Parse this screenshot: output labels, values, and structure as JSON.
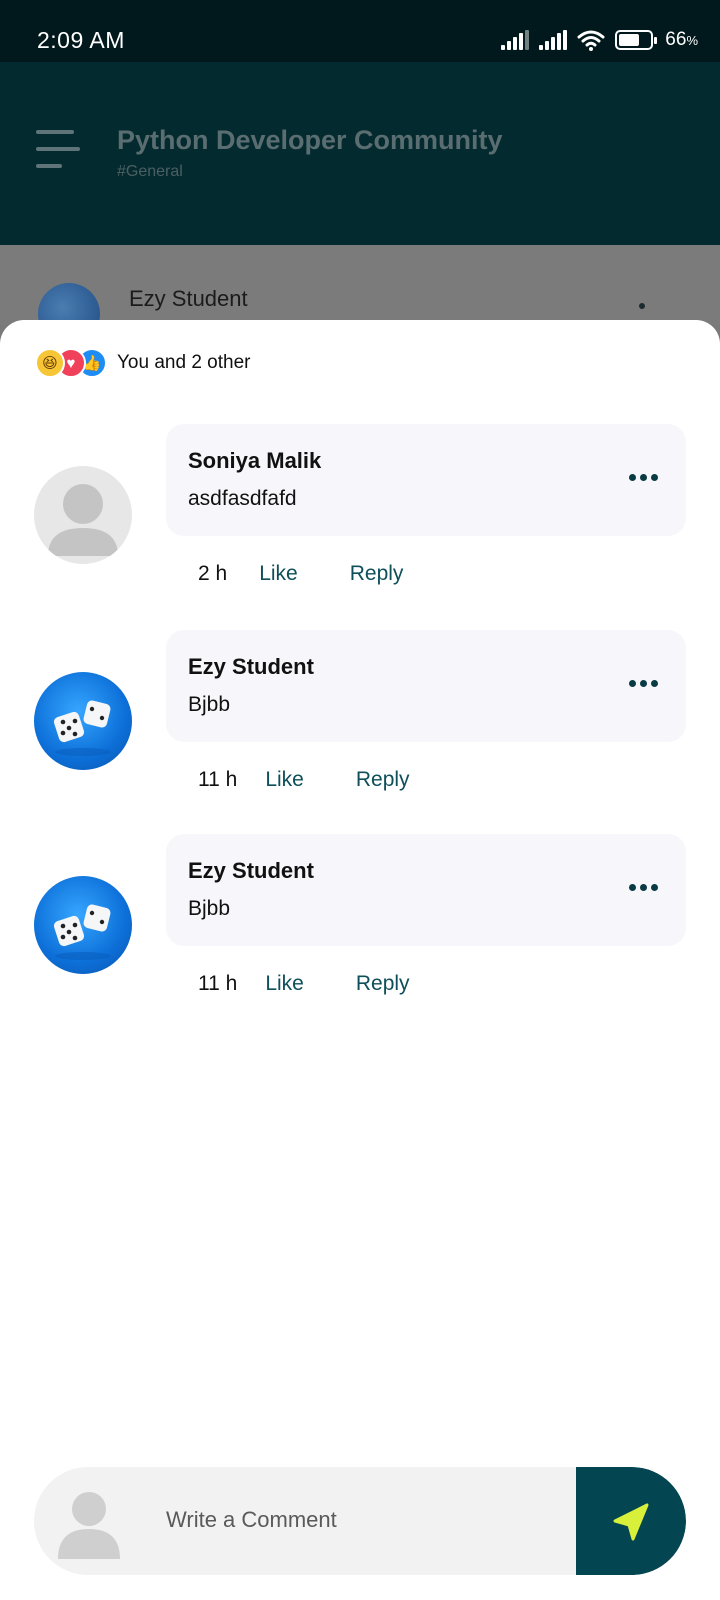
{
  "status_bar": {
    "time": "2:09 AM",
    "battery_percent": "66",
    "battery_suffix": "%",
    "icons": [
      "signal-icon",
      "signal-icon",
      "wifi-icon",
      "battery-icon"
    ]
  },
  "header": {
    "title": "Python Developer Community",
    "channel": "#General",
    "menu_icon": "hamburger-menu-icon"
  },
  "background_post": {
    "author": "Ezy Student"
  },
  "reactions": {
    "icons": [
      "haha-emoji-icon",
      "love-icon",
      "like-icon"
    ],
    "summary": "You and 2 other"
  },
  "comments": [
    {
      "author": "Soniya Malik",
      "text": "asdfasdfafd",
      "time": "2 h",
      "like_label": "Like",
      "reply_label": "Reply",
      "avatar": "default-avatar"
    },
    {
      "author": "Ezy Student",
      "text": "Bjbb",
      "time": "11 h",
      "like_label": "Like",
      "reply_label": "Reply",
      "avatar": "dice-avatar"
    },
    {
      "author": "Ezy Student",
      "text": "Bjbb",
      "time": "11 h",
      "like_label": "Like",
      "reply_label": "Reply",
      "avatar": "dice-avatar"
    }
  ],
  "composer": {
    "placeholder": "Write a Comment",
    "send_icon": "send-icon"
  },
  "colors": {
    "status_bar": "#01181c",
    "header_bg": "#032a2f",
    "accent": "#034550",
    "action_text": "#0e4f5a",
    "send_arrow": "#d8f03a"
  }
}
